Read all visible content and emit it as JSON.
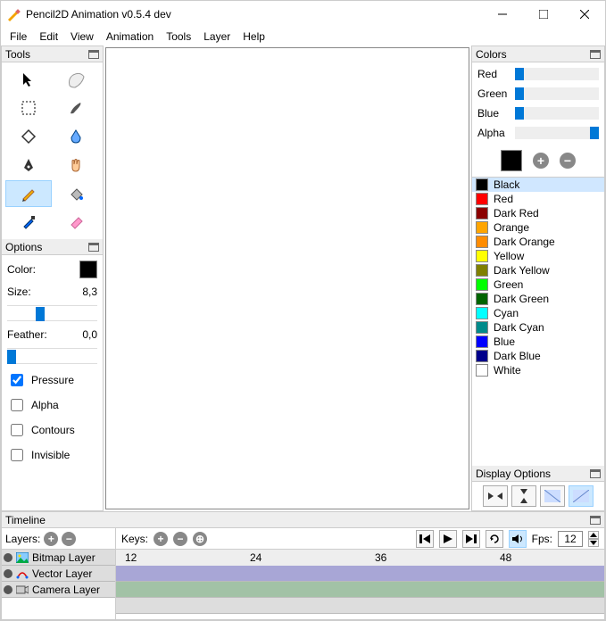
{
  "window": {
    "title": "Pencil2D Animation v0.5.4 dev"
  },
  "menu": [
    "File",
    "Edit",
    "View",
    "Animation",
    "Tools",
    "Layer",
    "Help"
  ],
  "tools_panel": {
    "title": "Tools",
    "selected": "pencil"
  },
  "options_panel": {
    "title": "Options",
    "color_label": "Color:",
    "size_label": "Size:",
    "size_value": "8,3",
    "feather_label": "Feather:",
    "feather_value": "0,0",
    "pressure": "Pressure",
    "pressure_on": true,
    "alpha": "Alpha",
    "contours": "Contours",
    "invisible": "Invisible"
  },
  "colors_panel": {
    "title": "Colors",
    "sliders": {
      "red": "Red",
      "green": "Green",
      "blue": "Blue",
      "alpha": "Alpha"
    },
    "list": [
      {
        "name": "Black",
        "hex": "#000000",
        "sel": true
      },
      {
        "name": "Red",
        "hex": "#ff0000"
      },
      {
        "name": "Dark Red",
        "hex": "#8b0000"
      },
      {
        "name": "Orange",
        "hex": "#ffa500"
      },
      {
        "name": "Dark Orange",
        "hex": "#ff8c00"
      },
      {
        "name": "Yellow",
        "hex": "#ffff00"
      },
      {
        "name": "Dark Yellow",
        "hex": "#808000"
      },
      {
        "name": "Green",
        "hex": "#00ff00"
      },
      {
        "name": "Dark Green",
        "hex": "#006400"
      },
      {
        "name": "Cyan",
        "hex": "#00ffff"
      },
      {
        "name": "Dark Cyan",
        "hex": "#008b8b"
      },
      {
        "name": "Blue",
        "hex": "#0000ff"
      },
      {
        "name": "Dark Blue",
        "hex": "#00008b"
      },
      {
        "name": "White",
        "hex": "#ffffff"
      }
    ]
  },
  "display_panel": {
    "title": "Display Options"
  },
  "timeline": {
    "title": "Timeline",
    "layers_label": "Layers:",
    "keys_label": "Keys:",
    "fps_label": "Fps:",
    "fps_value": "12",
    "ruler": [
      "12",
      "24",
      "36",
      "48"
    ],
    "layers": [
      {
        "name": "Bitmap Layer",
        "type": "bitmap"
      },
      {
        "name": "Vector Layer",
        "type": "vector"
      },
      {
        "name": "Camera Layer",
        "type": "camera"
      }
    ]
  }
}
